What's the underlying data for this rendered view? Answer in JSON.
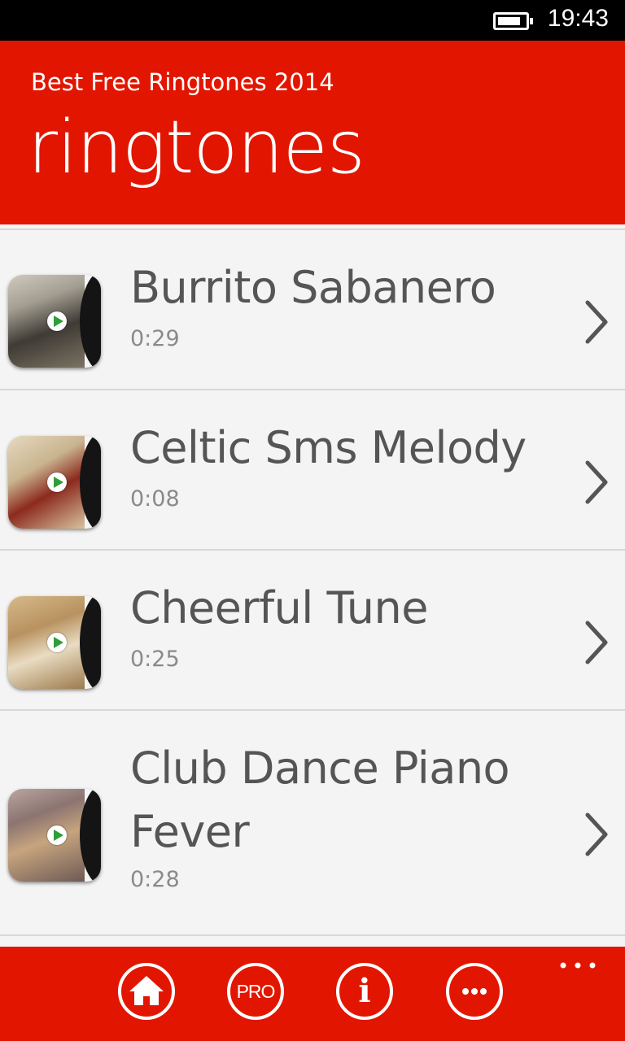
{
  "status_bar": {
    "time": "19:43",
    "battery_icon": "battery-icon",
    "battery_level": 0.85
  },
  "header": {
    "app_title": "Best Free Ringtones 2014",
    "page_title": "ringtones"
  },
  "tracks": [
    {
      "title": "Burrito Sabanero",
      "duration": "0:29",
      "icon": "play-icon"
    },
    {
      "title": "Celtic Sms Melody",
      "duration": "0:08",
      "icon": "play-icon"
    },
    {
      "title": "Cheerful Tune",
      "duration": "0:25",
      "icon": "play-icon"
    },
    {
      "title": "Club Dance Piano Fever",
      "title_line1": "Club Dance Piano",
      "title_line2": "Fever",
      "duration": "0:28",
      "icon": "play-icon"
    }
  ],
  "appbar": {
    "buttons": [
      {
        "icon": "home-icon"
      },
      {
        "icon": "pro-icon",
        "label": "PRO"
      },
      {
        "icon": "info-icon",
        "label": "i"
      },
      {
        "icon": "more-icon"
      }
    ],
    "overflow_icon": "ellipsis-icon"
  },
  "colors": {
    "accent": "#e21600",
    "background": "#f4f4f4",
    "text_primary": "#555555",
    "text_secondary": "#8a8a8a"
  }
}
